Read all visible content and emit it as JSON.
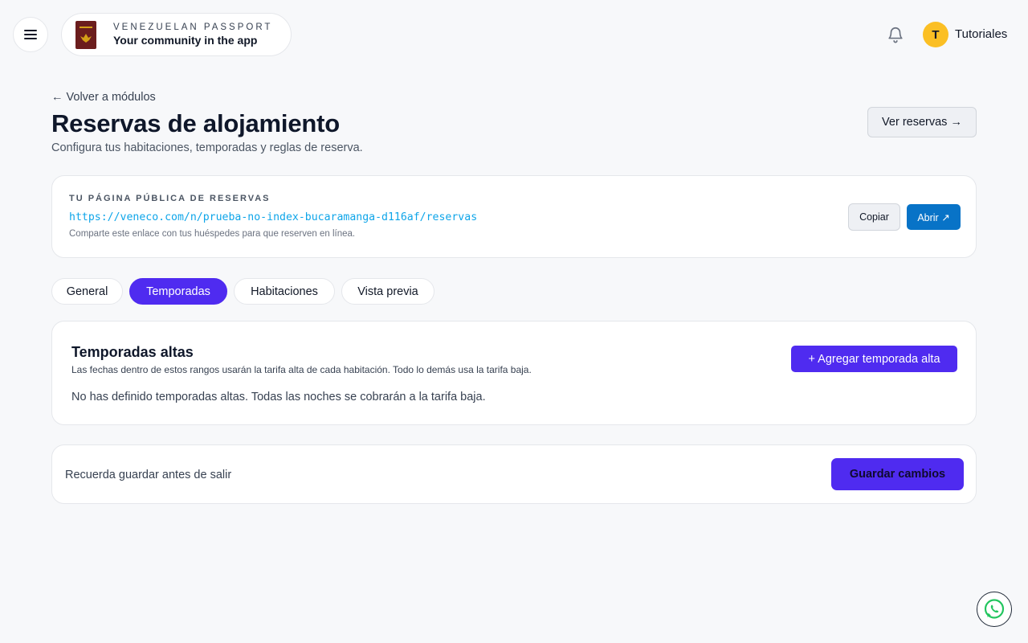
{
  "header": {
    "brand_kicker": "VENEZUELAN PASSPORT",
    "brand_subtitle": "Your community in the app",
    "user_initial": "T",
    "user_name": "Tutoriales",
    "icons": [
      "hamburger-menu-icon",
      "passport-logo",
      "bell-icon",
      "whatsapp-icon"
    ]
  },
  "page": {
    "back_link": "← Volver a módulos",
    "title": "Reservas de alojamiento",
    "subtitle": "Configura tus habitaciones, temporadas y reglas de reserva.",
    "ver_reservas": "Ver reservas →"
  },
  "public_page": {
    "label": "TU PÁGINA PÚBLICA DE RESERVAS",
    "url": "https://veneco.com/n/prueba-no-index-bucaramanga-d116af/reservas",
    "hint": "Comparte este enlace con tus huéspedes para que reserven en línea.",
    "copy_label": "Copiar",
    "open_label": "Abrir ↗"
  },
  "tabs": [
    {
      "label": "General",
      "active": false
    },
    {
      "label": "Temporadas",
      "active": true
    },
    {
      "label": "Habitaciones",
      "active": false
    },
    {
      "label": "Vista previa",
      "active": false
    }
  ],
  "seasons": {
    "title": "Temporadas altas",
    "description": "Las fechas dentro de estos rangos usarán la tarifa alta de cada habitación. Todo lo demás usa la tarifa baja.",
    "add_label": "+ Agregar temporada alta",
    "empty_message": "No has definido temporadas altas. Todas las noches se cobrarán a la tarifa baja."
  },
  "save_bar": {
    "hint": "Recuerda guardar antes de salir",
    "save_label": "Guardar cambios"
  },
  "colors": {
    "accent": "#4f2bf0",
    "link": "#0ea5e9",
    "open_button": "#0873c7",
    "avatar": "#fbbf24",
    "background": "#f7f8fa"
  }
}
